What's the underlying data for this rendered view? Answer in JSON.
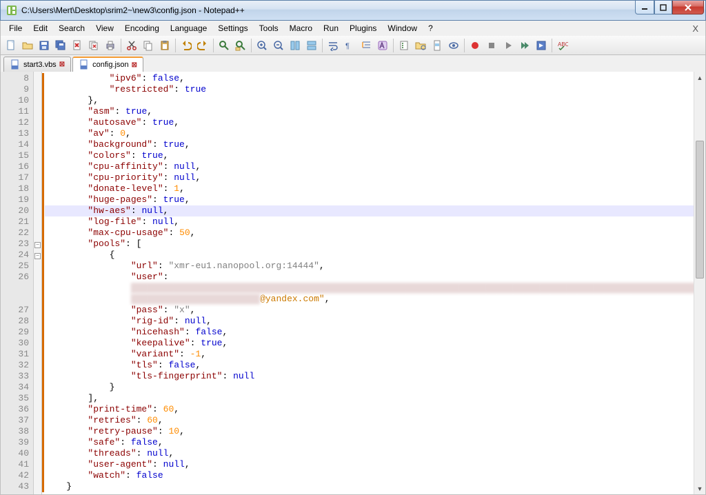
{
  "window": {
    "title": "C:\\Users\\Mert\\Desktop\\srim2~\\new3\\config.json - Notepad++"
  },
  "menu": [
    "File",
    "Edit",
    "Search",
    "View",
    "Encoding",
    "Language",
    "Settings",
    "Tools",
    "Macro",
    "Run",
    "Plugins",
    "Window",
    "?"
  ],
  "tabs": [
    {
      "label": "start3.vbs",
      "active": false
    },
    {
      "label": "config.json",
      "active": true
    }
  ],
  "lineStart": 8,
  "highlightLine": 20,
  "redacted_mail_suffix": "@yandex.com",
  "foldMarks": {
    "23": "-",
    "24": "-"
  },
  "code": [
    [
      [
        "            ",
        ""
      ],
      [
        "\"ipv6\"",
        "key"
      ],
      [
        ": ",
        "punc"
      ],
      [
        "false",
        "bool"
      ],
      [
        ",",
        "punc"
      ]
    ],
    [
      [
        "            ",
        ""
      ],
      [
        "\"restricted\"",
        "key"
      ],
      [
        ": ",
        "punc"
      ],
      [
        "true",
        "bool"
      ]
    ],
    [
      [
        "        },",
        "punc"
      ]
    ],
    [
      [
        "        ",
        ""
      ],
      [
        "\"asm\"",
        "key"
      ],
      [
        ": ",
        "punc"
      ],
      [
        "true",
        "bool"
      ],
      [
        ",",
        "punc"
      ]
    ],
    [
      [
        "        ",
        ""
      ],
      [
        "\"autosave\"",
        "key"
      ],
      [
        ": ",
        "punc"
      ],
      [
        "true",
        "bool"
      ],
      [
        ",",
        "punc"
      ]
    ],
    [
      [
        "        ",
        ""
      ],
      [
        "\"av\"",
        "key"
      ],
      [
        ": ",
        "punc"
      ],
      [
        "0",
        "num"
      ],
      [
        ",",
        "punc"
      ]
    ],
    [
      [
        "        ",
        ""
      ],
      [
        "\"background\"",
        "key"
      ],
      [
        ": ",
        "punc"
      ],
      [
        "true",
        "bool"
      ],
      [
        ",",
        "punc"
      ]
    ],
    [
      [
        "        ",
        ""
      ],
      [
        "\"colors\"",
        "key"
      ],
      [
        ": ",
        "punc"
      ],
      [
        "true",
        "bool"
      ],
      [
        ",",
        "punc"
      ]
    ],
    [
      [
        "        ",
        ""
      ],
      [
        "\"cpu-affinity\"",
        "key"
      ],
      [
        ": ",
        "punc"
      ],
      [
        "null",
        "null"
      ],
      [
        ",",
        "punc"
      ]
    ],
    [
      [
        "        ",
        ""
      ],
      [
        "\"cpu-priority\"",
        "key"
      ],
      [
        ": ",
        "punc"
      ],
      [
        "null",
        "null"
      ],
      [
        ",",
        "punc"
      ]
    ],
    [
      [
        "        ",
        ""
      ],
      [
        "\"donate-level\"",
        "key"
      ],
      [
        ": ",
        "punc"
      ],
      [
        "1",
        "num"
      ],
      [
        ",",
        "punc"
      ]
    ],
    [
      [
        "        ",
        ""
      ],
      [
        "\"huge-pages\"",
        "key"
      ],
      [
        ": ",
        "punc"
      ],
      [
        "true",
        "bool"
      ],
      [
        ",",
        "punc"
      ]
    ],
    [
      [
        "        ",
        ""
      ],
      [
        "\"hw-aes\"",
        "key"
      ],
      [
        ": ",
        "punc"
      ],
      [
        "null",
        "null"
      ],
      [
        ",",
        "punc"
      ]
    ],
    [
      [
        "        ",
        ""
      ],
      [
        "\"log-file\"",
        "key"
      ],
      [
        ": ",
        "punc"
      ],
      [
        "null",
        "null"
      ],
      [
        ",",
        "punc"
      ]
    ],
    [
      [
        "        ",
        ""
      ],
      [
        "\"max-cpu-usage\"",
        "key"
      ],
      [
        ": ",
        "punc"
      ],
      [
        "50",
        "num"
      ],
      [
        ",",
        "punc"
      ]
    ],
    [
      [
        "        ",
        ""
      ],
      [
        "\"pools\"",
        "key"
      ],
      [
        ": [",
        "punc"
      ]
    ],
    [
      [
        "            {",
        "punc"
      ]
    ],
    [
      [
        "                ",
        ""
      ],
      [
        "\"url\"",
        "key"
      ],
      [
        ": ",
        "punc"
      ],
      [
        "\"xmr-eu1.nanopool.org:14444\"",
        "str"
      ],
      [
        ",",
        "punc"
      ]
    ],
    [
      [
        "                ",
        ""
      ],
      [
        "\"user\"",
        "key"
      ],
      [
        ":",
        "punc"
      ]
    ],
    [
      [
        "                ",
        ""
      ],
      [
        "\"pass\"",
        "key"
      ],
      [
        ": ",
        "punc"
      ],
      [
        "\"x\"",
        "str"
      ],
      [
        ",",
        "punc"
      ]
    ],
    [
      [
        "                ",
        ""
      ],
      [
        "\"rig-id\"",
        "key"
      ],
      [
        ": ",
        "punc"
      ],
      [
        "null",
        "null"
      ],
      [
        ",",
        "punc"
      ]
    ],
    [
      [
        "                ",
        ""
      ],
      [
        "\"nicehash\"",
        "key"
      ],
      [
        ": ",
        "punc"
      ],
      [
        "false",
        "bool"
      ],
      [
        ",",
        "punc"
      ]
    ],
    [
      [
        "                ",
        ""
      ],
      [
        "\"keepalive\"",
        "key"
      ],
      [
        ": ",
        "punc"
      ],
      [
        "true",
        "bool"
      ],
      [
        ",",
        "punc"
      ]
    ],
    [
      [
        "                ",
        ""
      ],
      [
        "\"variant\"",
        "key"
      ],
      [
        ": ",
        "punc"
      ],
      [
        "-1",
        "num"
      ],
      [
        ",",
        "punc"
      ]
    ],
    [
      [
        "                ",
        ""
      ],
      [
        "\"tls\"",
        "key"
      ],
      [
        ": ",
        "punc"
      ],
      [
        "false",
        "bool"
      ],
      [
        ",",
        "punc"
      ]
    ],
    [
      [
        "                ",
        ""
      ],
      [
        "\"tls-fingerprint\"",
        "key"
      ],
      [
        ": ",
        "punc"
      ],
      [
        "null",
        "null"
      ]
    ],
    [
      [
        "            }",
        "punc"
      ]
    ],
    [
      [
        "        ],",
        "punc"
      ]
    ],
    [
      [
        "        ",
        ""
      ],
      [
        "\"print-time\"",
        "key"
      ],
      [
        ": ",
        "punc"
      ],
      [
        "60",
        "num"
      ],
      [
        ",",
        "punc"
      ]
    ],
    [
      [
        "        ",
        ""
      ],
      [
        "\"retries\"",
        "key"
      ],
      [
        ": ",
        "punc"
      ],
      [
        "60",
        "num"
      ],
      [
        ",",
        "punc"
      ]
    ],
    [
      [
        "        ",
        ""
      ],
      [
        "\"retry-pause\"",
        "key"
      ],
      [
        ": ",
        "punc"
      ],
      [
        "10",
        "num"
      ],
      [
        ",",
        "punc"
      ]
    ],
    [
      [
        "        ",
        ""
      ],
      [
        "\"safe\"",
        "key"
      ],
      [
        ": ",
        "punc"
      ],
      [
        "false",
        "bool"
      ],
      [
        ",",
        "punc"
      ]
    ],
    [
      [
        "        ",
        ""
      ],
      [
        "\"threads\"",
        "key"
      ],
      [
        ": ",
        "punc"
      ],
      [
        "null",
        "null"
      ],
      [
        ",",
        "punc"
      ]
    ],
    [
      [
        "        ",
        ""
      ],
      [
        "\"user-agent\"",
        "key"
      ],
      [
        ": ",
        "punc"
      ],
      [
        "null",
        "null"
      ],
      [
        ",",
        "punc"
      ]
    ],
    [
      [
        "        ",
        ""
      ],
      [
        "\"watch\"",
        "key"
      ],
      [
        ": ",
        "punc"
      ],
      [
        "false",
        "bool"
      ]
    ],
    [
      [
        "    }",
        "punc"
      ]
    ]
  ]
}
